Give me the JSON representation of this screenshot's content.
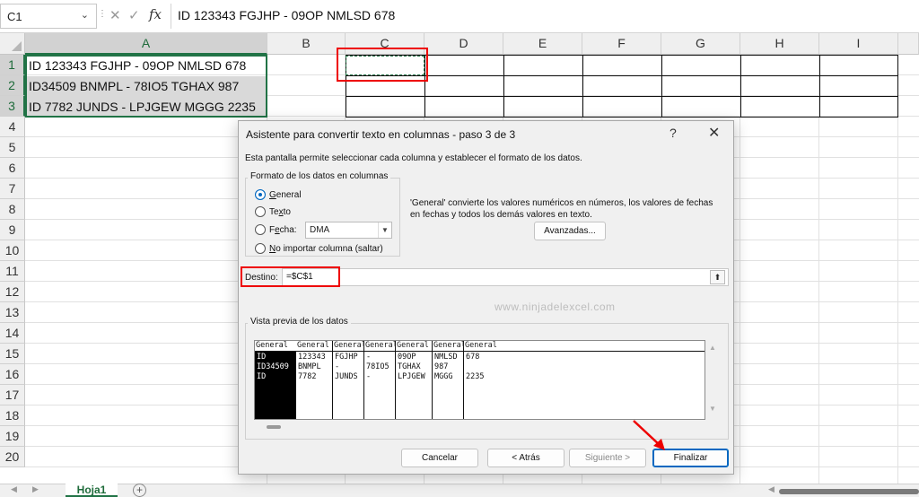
{
  "formula_bar": {
    "name_box": "C1",
    "chevron": "⌄",
    "cancel_glyph": "✕",
    "enter_glyph": "✓",
    "fx_label": "fx",
    "formula": "ID 123343 FGJHP - 09OP NMLSD 678"
  },
  "columns": [
    "A",
    "B",
    "C",
    "D",
    "E",
    "F",
    "G",
    "H",
    "I"
  ],
  "rows": [
    "1",
    "2",
    "3",
    "4",
    "5",
    "6",
    "7",
    "8",
    "9",
    "10",
    "11",
    "12",
    "13",
    "14",
    "15",
    "16",
    "17",
    "18",
    "19",
    "20"
  ],
  "cells": {
    "A1": "ID 123343 FGJHP - 09OP NMLSD 678",
    "A2": "ID34509 BNMPL - 78IO5 TGHAX 987",
    "A3": "ID 7782 JUNDS - LPJGEW MGGG 2235"
  },
  "sheet_tabs": {
    "active": "Hoja1",
    "add_glyph": "+"
  },
  "dialog": {
    "title": "Asistente para convertir texto en columnas - paso 3 de 3",
    "help": "?",
    "close": "✕",
    "description": "Esta pantalla permite seleccionar cada columna y establecer el formato de los datos.",
    "format_group_title": "Formato de los datos en columnas",
    "options": {
      "general": "eneral",
      "general_hotkey": "G",
      "text": "Te",
      "text_hotkey": "x",
      "text_rest": "to",
      "date": "F",
      "date_hotkey": "e",
      "date_rest": "cha:",
      "skip": "o importar columna (saltar)",
      "skip_hotkey": "N"
    },
    "date_format": "DMA",
    "explanation": "'General' convierte los valores numéricos en números, los valores de fechas en fechas y todos los demás valores en texto.",
    "advanced_button": "Avanzadas...",
    "destination_label": "Destino:",
    "destination_value": "=$C$1",
    "watermark": "www.ninjadelexcel.com",
    "preview_title": "Vista previa de los datos",
    "preview": {
      "headers": [
        "General",
        "General",
        "General",
        "General",
        "General",
        "General",
        "General"
      ],
      "rows": [
        [
          "ID",
          "123343",
          "FGJHP",
          "-",
          "09OP",
          "NMLSD",
          "678"
        ],
        [
          "ID34509",
          "BNMPL",
          "-",
          "78IO5",
          "TGHAX",
          "987",
          ""
        ],
        [
          "ID",
          "7782",
          "JUNDS",
          "-",
          "LPJGEW",
          "MGGG",
          "2235"
        ]
      ]
    },
    "buttons": {
      "cancel": "Cancelar",
      "back": "< Atrás",
      "next": "Siguiente >",
      "finish": "Finalizar"
    }
  },
  "colors": {
    "excel_green": "#217346",
    "highlight_red": "#e00000",
    "dialog_bg": "#f0f0f0",
    "radio_blue": "#0067c0"
  }
}
